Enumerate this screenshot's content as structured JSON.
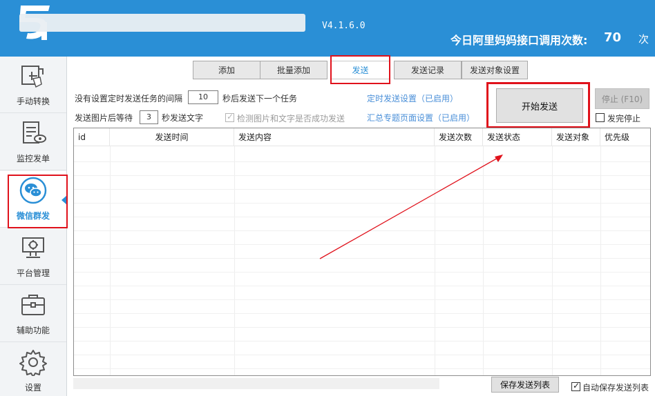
{
  "header": {
    "version": "V4.1.6.0",
    "api_label": "今日阿里妈妈接口调用次数:",
    "api_count": "70",
    "api_unit": "次",
    "brand_color": "#2a8fd6"
  },
  "sidebar": {
    "items": [
      {
        "label": "手动转换",
        "icon": "hand-convert-icon"
      },
      {
        "label": "监控发单",
        "icon": "monitor-document-icon"
      },
      {
        "label": "微信群发",
        "icon": "wechat-icon"
      },
      {
        "label": "平台管理",
        "icon": "monitor-gear-icon"
      },
      {
        "label": "辅助功能",
        "icon": "toolbox-icon"
      },
      {
        "label": "设置",
        "icon": "gear-icon"
      }
    ],
    "active": "微信群发"
  },
  "tabs": [
    {
      "label": "添加"
    },
    {
      "label": "批量添加"
    },
    {
      "label": "发送"
    },
    {
      "label": "发送记录"
    },
    {
      "label": "发送对象设置"
    }
  ],
  "active_tab": "发送",
  "settings": {
    "interval_prefix": "没有设置定时发送任务的间隔",
    "interval_value": "10",
    "interval_suffix": "秒后发送下一个任务",
    "image_wait_prefix": "发送图片后等待",
    "image_wait_value": "3",
    "image_wait_suffix": "秒发送文字",
    "check_success_label": "检测图片和文字是否成功发送",
    "check_success_checked": true,
    "timed_send_link": "定时发送设置（已启用）",
    "topic_page_link": "汇总专题页面设置（已启用）"
  },
  "actions": {
    "start_label": "开始发送",
    "stop_label": "停止 (F10)",
    "stop_after_label": "发完停止",
    "stop_after_checked": false
  },
  "table": {
    "columns": [
      "id",
      "发送时间",
      "发送内容",
      "发送次数",
      "发送状态",
      "发送对象",
      "优先级"
    ]
  },
  "footer": {
    "save_list_label": "保存发送列表",
    "auto_save_label": "自动保存发送列表",
    "auto_save_checked": true
  },
  "colors": {
    "highlight_red": "#e0111b",
    "link_blue": "#4a8fd8"
  }
}
